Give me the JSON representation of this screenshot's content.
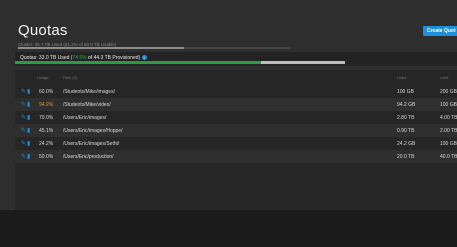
{
  "title": "Quotas",
  "create_button": "Create Quot",
  "cluster": {
    "text": "Cluster: 36.7 TB Used (61.2% of 60.0 TB Usable)",
    "used_fraction": 0.612
  },
  "quota_summary": {
    "prefix": "Quotas: 33.0 TB Used (",
    "pct": "74.5%",
    "suffix": " of 44.3 TB Provisioned)",
    "used_fraction": 0.745
  },
  "table": {
    "headers": {
      "usage": "Usage",
      "path": "Path (8)",
      "used": "Used",
      "limit": "Limit"
    },
    "rows": [
      {
        "usage": "60.0%",
        "path": "/Students/Mike/images/",
        "used": "100 GB",
        "limit": "200 GB",
        "warn": false
      },
      {
        "usage": "94.2%",
        "path": "/Students/Mike/video/",
        "used": "94.2 GB",
        "limit": "100 GB",
        "warn": true
      },
      {
        "usage": "70.0%",
        "path": "/Users/Eric/images/",
        "used": "2.80 TB",
        "limit": "4.00 TB",
        "warn": false
      },
      {
        "usage": "45.1%",
        "path": "/Users/Eric/images/Hoppe/",
        "used": "0.90 TB",
        "limit": "2.00 TB",
        "warn": false
      },
      {
        "usage": "24.2%",
        "path": "/Users/Eric/images/Sethi/",
        "used": "24.2 GB",
        "limit": "100 GB",
        "warn": false
      },
      {
        "usage": "50.0%",
        "path": "/Users/Eric/production/",
        "used": "20.0 TB",
        "limit": "40.0 TB",
        "warn": false
      }
    ]
  },
  "icons": {
    "edit": "pencil-icon",
    "delete": "trash-icon",
    "info": "info-icon"
  },
  "colors": {
    "accent": "#1d8fd8",
    "good": "#27b34d",
    "warn": "#e0a100"
  }
}
